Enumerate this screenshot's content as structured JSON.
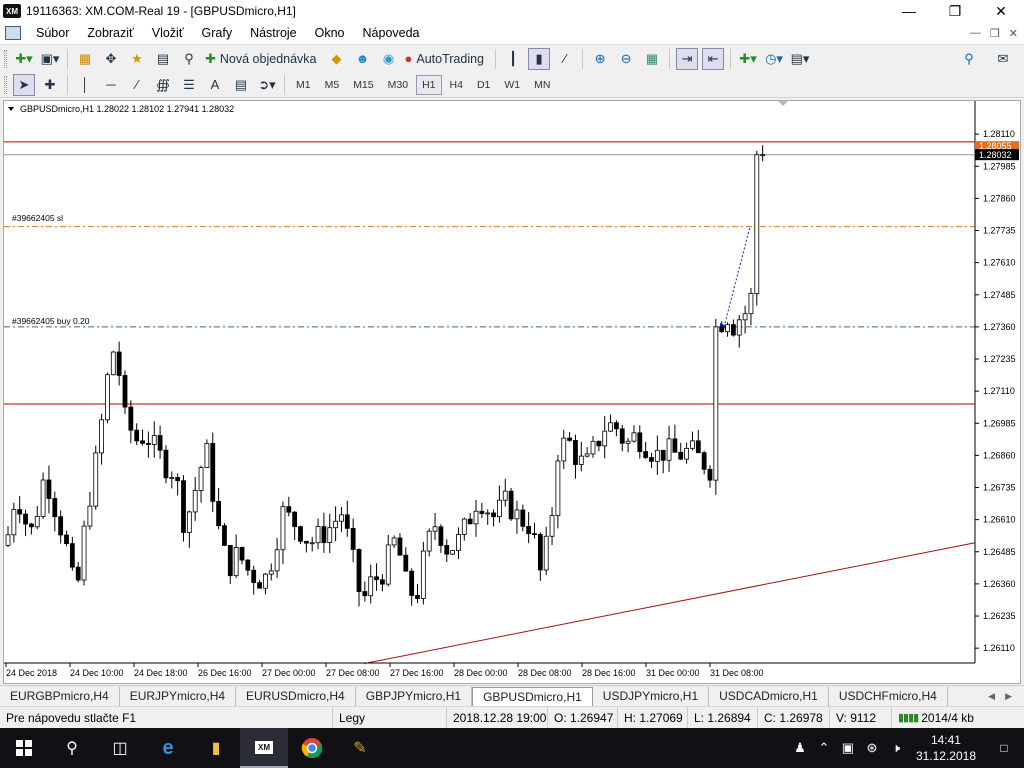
{
  "window": {
    "title": "19116363: XM.COM-Real 19 - [GBPUSDmicro,H1]",
    "logo": "XM"
  },
  "menu": [
    "Súbor",
    "Zobraziť",
    "Vložiť",
    "Grafy",
    "Nástroje",
    "Okno",
    "Nápoveda"
  ],
  "toolbar": {
    "new_order": "Nová objednávka",
    "autotrading": "AutoTrading"
  },
  "timeframes": [
    "M1",
    "M5",
    "M15",
    "M30",
    "H1",
    "H4",
    "D1",
    "W1",
    "MN"
  ],
  "active_timeframe": "H1",
  "chart": {
    "header": "GBPUSDmicro,H1  1.28022 1.28102 1.27941 1.28032",
    "sl_label": "#39662405 sl",
    "buy_label": "#39662405 buy 0.20",
    "price_tag": "1.28032",
    "ask_tag": "1.28055",
    "colors": {
      "bull": "#000000",
      "sl_line": "#e07020",
      "order_line": "#208040",
      "hline": "#c00000",
      "trend": "#a01010"
    }
  },
  "chart_data": {
    "type": "candlestick",
    "symbol": "GBPUSDmicro",
    "timeframe": "H1",
    "ylim": [
      1.2606,
      1.282
    ],
    "y_ticks": [
      "1.28110",
      "1.27985",
      "1.27860",
      "1.27735",
      "1.27610",
      "1.27485",
      "1.27360",
      "1.27235",
      "1.27110",
      "1.26985",
      "1.26860",
      "1.26735",
      "1.26610",
      "1.26485",
      "1.26360",
      "1.26235",
      "1.26110"
    ],
    "x_ticks": [
      "24 Dec 2018",
      "24 Dec 10:00",
      "24 Dec 18:00",
      "26 Dec 16:00",
      "27 Dec 00:00",
      "27 Dec 08:00",
      "27 Dec 16:00",
      "28 Dec 00:00",
      "28 Dec 08:00",
      "28 Dec 16:00",
      "31 Dec 00:00",
      "31 Dec 08:00"
    ],
    "horizontal_lines": [
      1.2808,
      1.2803,
      1.2775,
      1.2736,
      1.2706
    ],
    "trend_line": [
      1.2605,
      1.2652
    ],
    "last_price": 1.28032
  },
  "tabs": [
    "EURGBPmicro,H4",
    "EURJPYmicro,H4",
    "EURUSDmicro,H4",
    "GBPJPYmicro,H1",
    "GBPUSDmicro,H1",
    "USDJPYmicro,H1",
    "USDCADmicro,H1",
    "USDCHFmicro,H4"
  ],
  "active_tab": "GBPUSDmicro,H1",
  "status": {
    "help": "Pre nápovedu stlačte F1",
    "profile": "Legy",
    "datetime": "2018.12.28 19:00",
    "open": "O: 1.26947",
    "high": "H: 1.27069",
    "low": "L: 1.26894",
    "close": "C: 1.26978",
    "volume": "V: 9112",
    "traffic": "2014/4 kb"
  },
  "taskbar": {
    "time": "14:41",
    "date": "31.12.2018"
  }
}
